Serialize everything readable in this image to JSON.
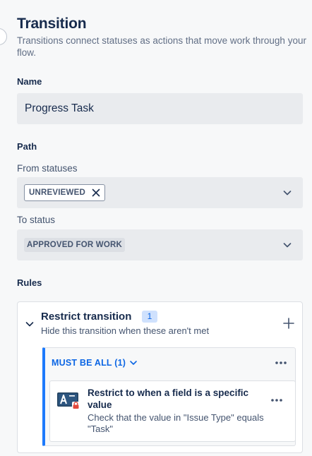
{
  "panel": {
    "title": "Transition",
    "subtitle": "Transitions connect statuses as actions that move work through your flow."
  },
  "name_section": {
    "label": "Name",
    "value": "Progress Task"
  },
  "path_section": {
    "label": "Path",
    "from_label": "From statuses",
    "from_chips": [
      "UNREVIEWED"
    ],
    "to_label": "To status",
    "to_value": "APPROVED FOR WORK"
  },
  "rules_section": {
    "label": "Rules",
    "card": {
      "title": "Restrict transition",
      "count": "1",
      "description": "Hide this transition when these aren't met",
      "group": {
        "label": "MUST BE ALL (1)",
        "rule": {
          "title": "Restrict to when a field is a specific value",
          "description": "Check that the value in \"Issue Type\" equals \"Task\""
        }
      }
    }
  },
  "colors": {
    "accent_blue": "#0c66e4",
    "group_border": "#1d7afc",
    "field_bg": "#e9ebee"
  },
  "icons": {
    "from_chevron": "chevron-down-icon",
    "to_chevron": "chevron-down-icon",
    "remove_chip": "close-icon",
    "expand": "chevron-down-icon",
    "add_rule": "plus-icon",
    "more": "more-horizontal-icon",
    "rule_type": "field-restriction-icon"
  }
}
